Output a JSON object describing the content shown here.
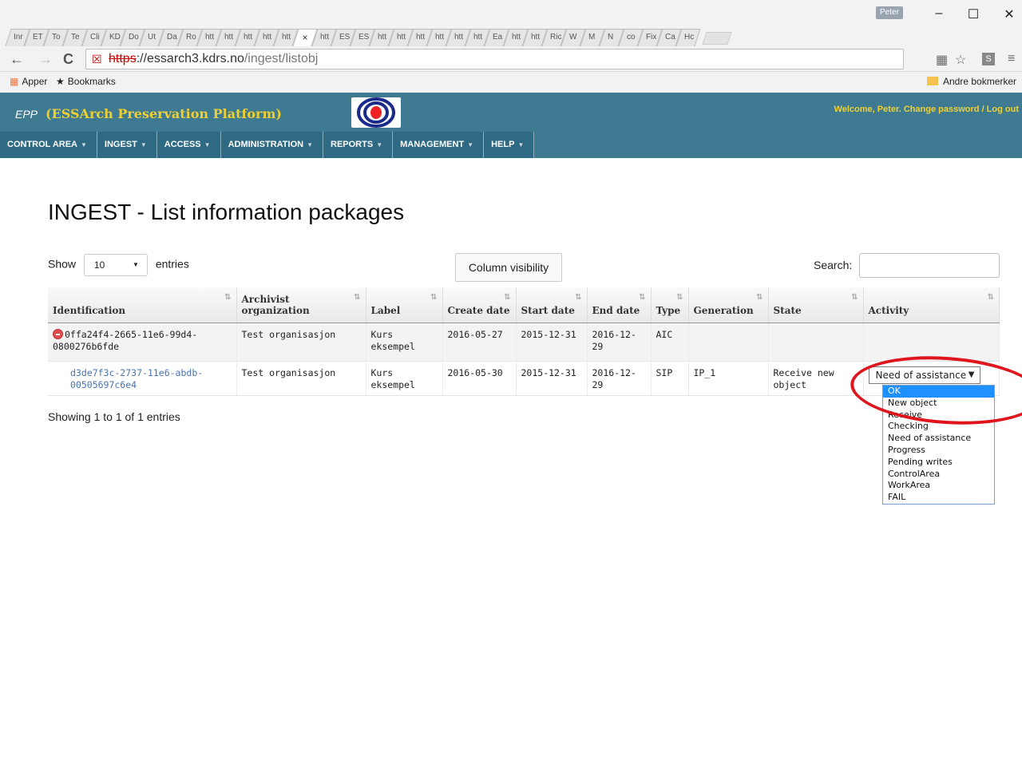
{
  "browser": {
    "tabs": [
      "Inr",
      "ET",
      "To",
      "Te",
      "Cli",
      "KD",
      "Do",
      "Ut",
      "Da",
      "Ro",
      "htt",
      "htt",
      "htt",
      "htt",
      "htt",
      "×",
      "htt",
      "ES",
      "ES",
      "htt",
      "htt",
      "htt",
      "htt",
      "htt",
      "htt",
      "Ea",
      "htt",
      "htt",
      "Ric",
      "W",
      "M",
      "N",
      "co",
      "Fix",
      "Ca",
      "Hc"
    ],
    "active_tab_index": 15,
    "user_chip": "Peter",
    "url_scheme": "https",
    "url_host": "://essarch3.kdrs.no",
    "url_path": "/ingest/listobj",
    "bookmarks": {
      "apps": "Apper",
      "bookmarks": "Bookmarks",
      "other": "Andre bokmerker"
    }
  },
  "header": {
    "epp": "EPP",
    "name": "(ESSArch Preservation Platform)",
    "welcome": "Welcome, Peter. Change password / Log out",
    "colors": {
      "bar": "#3f7a93",
      "brand": "#f0d030"
    }
  },
  "nav": [
    "CONTROL AREA",
    "INGEST",
    "ACCESS",
    "ADMINISTRATION",
    "REPORTS",
    "MANAGEMENT",
    "HELP"
  ],
  "page": {
    "title": "INGEST - List information packages",
    "show_label": "Show",
    "entries_label": "entries",
    "page_length": "10",
    "column_visibility": "Column visibility",
    "search_label": "Search:",
    "search_value": "",
    "info": "Showing 1 to 1 of 1 entries"
  },
  "table": {
    "columns": [
      "Identification",
      "Archivist organization",
      "Label",
      "Create date",
      "Start date",
      "End date",
      "Type",
      "Generation",
      "State",
      "Activity"
    ],
    "rows": [
      {
        "id": "0ffa24f4-2665-11e6-99d4-0800276b6fde",
        "org": "Test organisasjon",
        "label": "Kurs eksempel",
        "create": "2016-05-27",
        "start": "2015-12-31",
        "end": "2016-12-29",
        "type": "AIC",
        "generation": "",
        "state": "",
        "activity": ""
      },
      {
        "id": "d3de7f3c-2737-11e6-abdb-00505697c6e4",
        "org": "Test organisasjon",
        "label": "Kurs eksempel",
        "create": "2016-05-30",
        "start": "2015-12-31",
        "end": "2016-12-29",
        "type": "SIP",
        "generation": "IP_1",
        "state": "Receive new object",
        "activity": "Need of assistance"
      }
    ]
  },
  "activity_options": [
    "OK",
    "New object",
    "Receive",
    "Checking",
    "Need of assistance",
    "Progress",
    "Pending writes",
    "ControlArea",
    "WorkArea",
    "FAIL"
  ],
  "activity_highlighted": "OK"
}
